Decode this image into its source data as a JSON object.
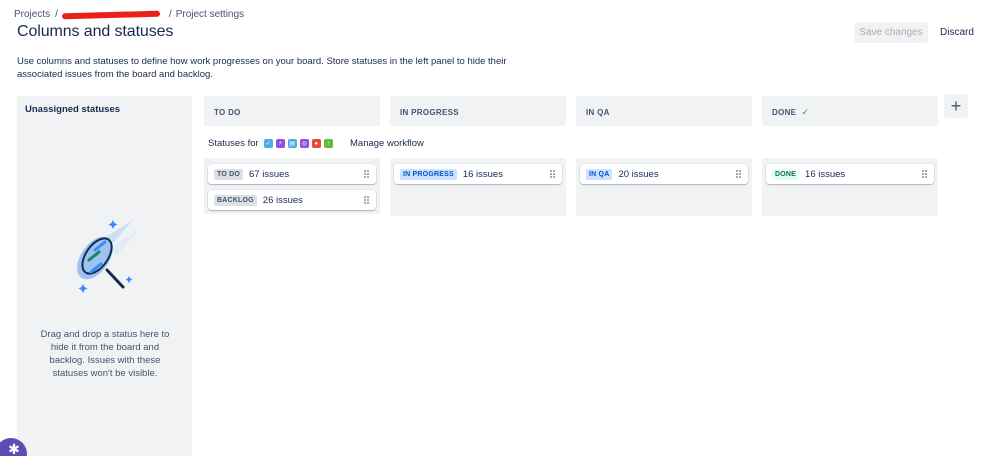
{
  "breadcrumb": {
    "root": "Projects",
    "sep1": "/",
    "sep2": "/",
    "current": "Project settings"
  },
  "page": {
    "title": "Columns and statuses",
    "description": "Use columns and statuses to define how work progresses on your board. Store statuses in the left panel to hide their associated issues from the board and backlog."
  },
  "actions": {
    "save_label": "Save changes",
    "discard_label": "Discard"
  },
  "unassigned": {
    "title": "Unassigned statuses",
    "hint": "Drag and drop a status here to hide it from the board and backlog. Issues with these statuses won't be visible."
  },
  "workflow": {
    "statuses_for_label": "Statuses for",
    "manage_label": "Manage workflow",
    "issue_type_icons": [
      {
        "name": "task-type-icon",
        "glyph": "✓",
        "color": "#4bade8"
      },
      {
        "name": "subtask-type-icon",
        "glyph": "⚡",
        "color": "#904ee2"
      },
      {
        "name": "story-type-icon",
        "glyph": "▤",
        "color": "#4bade8"
      },
      {
        "name": "feature-type-icon",
        "glyph": "◎",
        "color": "#904ee2"
      },
      {
        "name": "bug-type-icon",
        "glyph": "●",
        "color": "#e5493a"
      },
      {
        "name": "improvement-type-icon",
        "glyph": "↑",
        "color": "#63ba3c"
      }
    ]
  },
  "columns": [
    {
      "title": "TO DO",
      "check": "",
      "statuses": [
        {
          "label": "TO DO",
          "count": "67 issues",
          "tone": "gray"
        },
        {
          "label": "BACKLOG",
          "count": "26 issues",
          "tone": "gray"
        }
      ]
    },
    {
      "title": "IN PROGRESS",
      "check": "",
      "statuses": [
        {
          "label": "IN PROGRESS",
          "count": "16 issues",
          "tone": "blue"
        }
      ]
    },
    {
      "title": "IN QA",
      "check": "",
      "statuses": [
        {
          "label": "IN QA",
          "count": "20 issues",
          "tone": "blue"
        }
      ]
    },
    {
      "title": "DONE",
      "check": "✓",
      "statuses": [
        {
          "label": "DONE",
          "count": "16 issues",
          "tone": "green"
        }
      ]
    }
  ],
  "add_column_label": "+",
  "help_glyph": "✱",
  "colors": {
    "panel_bg": "#f1f2f4",
    "text": "#172b4d",
    "subtle": "#44546f",
    "fab": "#5e4db2",
    "redaction": "#e8211b"
  }
}
